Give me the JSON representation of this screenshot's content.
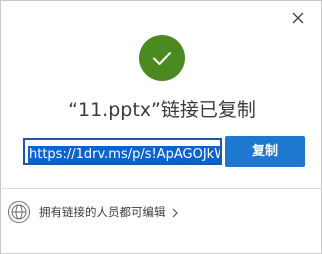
{
  "dialog": {
    "title": "“11.pptx”链接已复制",
    "link_value": "https://1drv.ms/p/s!ApAGOJkW",
    "copy_button_label": "复制",
    "permission_label": "拥有链接的人员都可编辑",
    "icons": {
      "close": "close-icon",
      "success": "checkmark-icon",
      "permission": "globe-icon",
      "expand": "chevron-right-icon"
    },
    "colors": {
      "success_green": "#4a8a21",
      "accent_blue": "#1e78d0",
      "selection_blue": "#0a64cf",
      "input_border": "#1f56a8"
    }
  }
}
